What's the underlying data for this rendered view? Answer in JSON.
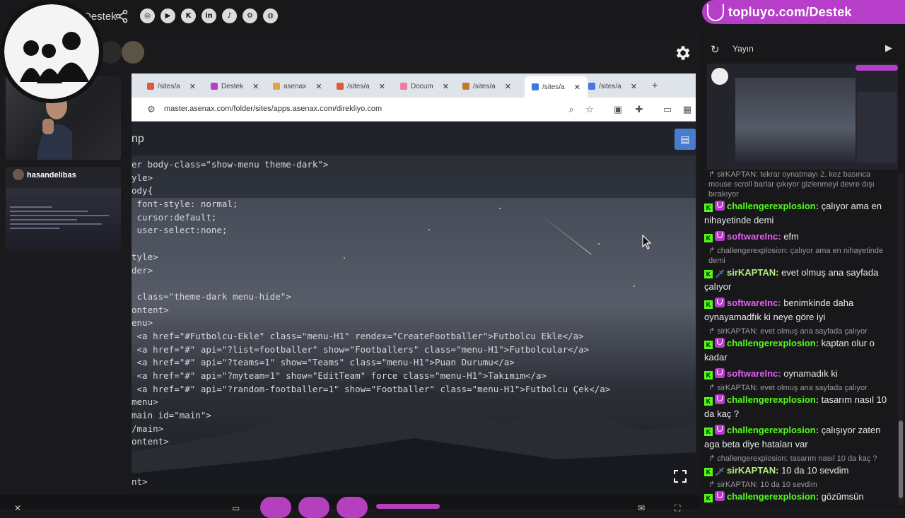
{
  "topbar": {
    "channel_title": "Destek",
    "socials": [
      {
        "icon": "instagram-icon",
        "glyph": "◎"
      },
      {
        "icon": "youtube-icon",
        "glyph": "▶"
      },
      {
        "icon": "kick-icon",
        "glyph": "K"
      },
      {
        "icon": "linkedin-icon",
        "glyph": "in"
      },
      {
        "icon": "tiktok-icon",
        "glyph": "♪"
      },
      {
        "icon": "steam-icon",
        "glyph": "⚙"
      },
      {
        "icon": "github-icon",
        "glyph": "◍"
      }
    ]
  },
  "streamer": {
    "name": "hasandelibas"
  },
  "browser": {
    "tabs": [
      {
        "label": "/sites/a",
        "color": "#e05a3c"
      },
      {
        "label": "Destek",
        "color": "#b63ec9"
      },
      {
        "label": "asenax",
        "color": "#e0a43c"
      },
      {
        "label": "/sites/a",
        "color": "#e05a3c"
      },
      {
        "label": "Docum",
        "color": "#f07aa0"
      },
      {
        "label": "/sites/a",
        "color": "#c07a2a"
      },
      {
        "label": "/sites/a",
        "color": "#3c7be0"
      },
      {
        "label": "/sites/a",
        "color": "#3c7be0"
      }
    ],
    "url": "master.asenax.com/folder/sites/apps.asenax.com/direkliyo.com"
  },
  "editor": {
    "title": "np",
    "lines": [
      "er body-class=\"show-menu theme-dark\">",
      "yle>",
      "ody{",
      " font-style: normal;",
      " cursor:default;",
      " user-select:none;",
      "",
      "tyle>",
      "der>",
      "",
      " class=\"theme-dark menu-hide\">",
      "ontent>",
      "enu>",
      " <a href=\"#Futbolcu-Ekle\" class=\"menu-H1\" rendex=\"CreateFootballer\">Futbolcu Ekle</a>",
      " <a href=\"#\" api=\"?list=footballer\" show=\"Footballers\" class=\"menu-H1\">Futbolcular</a>",
      " <a href=\"#\" api=\"?teams=1\" show=\"Teams\" class=\"menu-H1\">Puan Durumu</a>",
      " <a href=\"#\" api=\"?myteam=1\" show=\"EditTeam\" force class=\"menu-H1\">Takımım</a>",
      " <a href=\"#\" api=\"?random-footballer=1\" show=\"Footballer\" class=\"menu-H1\">Futbolcu Çek</a>",
      "menu>",
      "main id=\"main\">",
      "/main>",
      "ontent>",
      "",
      "",
      "nt>"
    ]
  },
  "chat": {
    "brand": "topluyo.com/Destek",
    "header_label": "Yayın",
    "messages": [
      {
        "type": "reply",
        "text": "sirKAPTAN: tekrar oynatmayı 2. kez basınca mouse scroll barlar çıkıyor gizlenmeyi devre dışı bırakıyor"
      },
      {
        "type": "msg",
        "badge": "sub",
        "user": "challengerexplosion",
        "user_color": "#53fc18",
        "text": "çalıyor ama en nihayetinde demi"
      },
      {
        "type": "msg",
        "badge": "sub",
        "user": "softwareInc",
        "user_color": "#e35df0",
        "text": "efm"
      },
      {
        "type": "reply",
        "text": "challengerexplosion: çalıyor ama en nihayetinde demi"
      },
      {
        "type": "msg",
        "badge": "sword",
        "user": "sirKAPTAN",
        "user_color": "#b6f080",
        "text": "evet olmuş ana sayfada çalıyor"
      },
      {
        "type": "msg",
        "badge": "sub",
        "user": "softwareInc",
        "user_color": "#e35df0",
        "text": "benimkinde daha oynayamadfık ki neye göre iyi"
      },
      {
        "type": "reply",
        "text": "sirKAPTAN: evet olmuş ana sayfada çalıyor"
      },
      {
        "type": "msg",
        "badge": "sub",
        "user": "challengerexplosion",
        "user_color": "#53fc18",
        "text": "kaptan olur o kadar"
      },
      {
        "type": "msg",
        "badge": "sub",
        "user": "softwareInc",
        "user_color": "#e35df0",
        "text": "oynamadık ki"
      },
      {
        "type": "reply",
        "text": "sirKAPTAN: evet olmuş ana sayfada çalıyor"
      },
      {
        "type": "msg",
        "badge": "sub",
        "user": "challengerexplosion",
        "user_color": "#53fc18",
        "text": "tasarım nasıl 10 da kaç ?"
      },
      {
        "type": "msg",
        "badge": "sub",
        "user": "challengerexplosion",
        "user_color": "#53fc18",
        "text": "çalışıyor zaten aga beta diye hataları var"
      },
      {
        "type": "reply",
        "text": "challengerexplosion: tasarım nasıl 10 da kaç ?"
      },
      {
        "type": "msg",
        "badge": "sword",
        "user": "sirKAPTAN",
        "user_color": "#b6f080",
        "text": "10 da 10 sevdim"
      },
      {
        "type": "reply",
        "text": "sirKAPTAN: 10 da 10 sevdim"
      },
      {
        "type": "msg",
        "badge": "sub",
        "user": "challengerexplosion",
        "user_color": "#53fc18",
        "text": "gözümsün"
      }
    ]
  },
  "colors": {
    "brand": "#b63ec9",
    "kick_green": "#53fc18",
    "background": "#18181b"
  }
}
